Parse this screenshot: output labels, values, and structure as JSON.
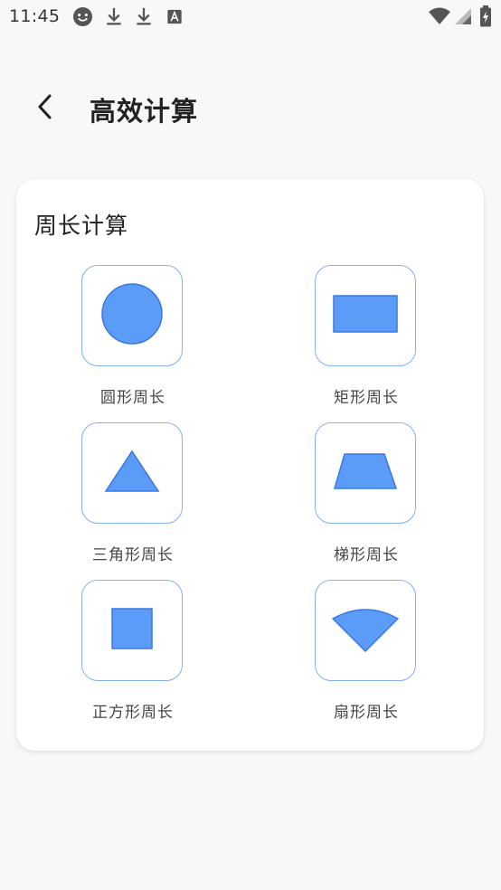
{
  "status_bar": {
    "time": "11:45",
    "icons": [
      "emoji-icon",
      "download-icon",
      "download-icon",
      "font-icon",
      "wifi-icon",
      "signal-icon",
      "battery-icon"
    ]
  },
  "toolbar": {
    "back_icon": "chevron-left-icon",
    "title": "高效计算"
  },
  "card": {
    "title": "周长计算",
    "items": [
      {
        "label": "圆形周长",
        "icon": "circle-icon"
      },
      {
        "label": "矩形周长",
        "icon": "rectangle-icon"
      },
      {
        "label": "三角形周长",
        "icon": "triangle-icon"
      },
      {
        "label": "梯形周长",
        "icon": "trapezoid-icon"
      },
      {
        "label": "正方形周长",
        "icon": "square-icon"
      },
      {
        "label": "扇形周长",
        "icon": "sector-icon"
      }
    ]
  },
  "colors": {
    "shape_fill": "#5b9cf9",
    "shape_stroke": "#3a78e0",
    "box_border": "#86aef0",
    "background": "#f8f8f8",
    "card": "#ffffff"
  }
}
